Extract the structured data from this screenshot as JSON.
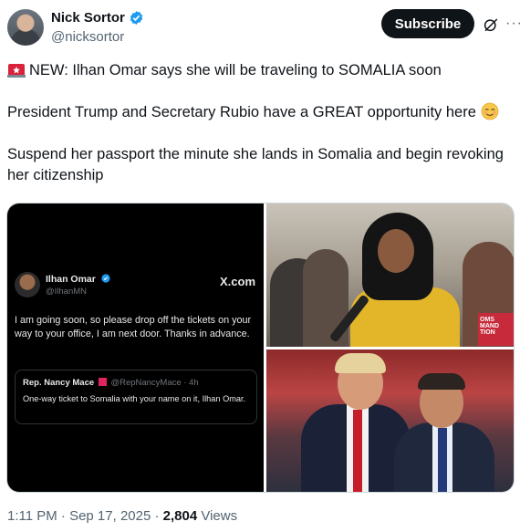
{
  "author": {
    "display_name": "Nick Sortor",
    "handle": "@nicksortor",
    "verified": true
  },
  "header": {
    "subscribe_label": "Subscribe",
    "more_label": "···"
  },
  "tweet": {
    "line1": "NEW: Ilhan Omar says she will be traveling to SOMALIA soon",
    "line2": "President Trump and Secretary Rubio have a GREAT opportunity here",
    "line3": "Suspend her passport the minute she lands in Somalia and begin revoking her citizenship"
  },
  "embedded_post": {
    "name": "Ilhan Omar",
    "handle": "@IlhanMN",
    "source": "X.com",
    "body": "I am going soon, so please drop off the tickets on your way to your office, I am next door. Thanks in advance.",
    "quote": {
      "name": "Rep. Nancy Mace",
      "meta": "@RepNancyMace · 4h",
      "body": "One-way ticket to Somalia with your name on it, Ilhan Omar."
    }
  },
  "photo_top": {
    "sign_text": "OMS MAND TION"
  },
  "footer": {
    "time": "1:11 PM · Sep 17, 2025 · ",
    "views_count": "2,804",
    "views_label": " Views"
  },
  "colors": {
    "accent": "#1d9bf0",
    "text": "#0f1419",
    "secondary": "#536471"
  }
}
